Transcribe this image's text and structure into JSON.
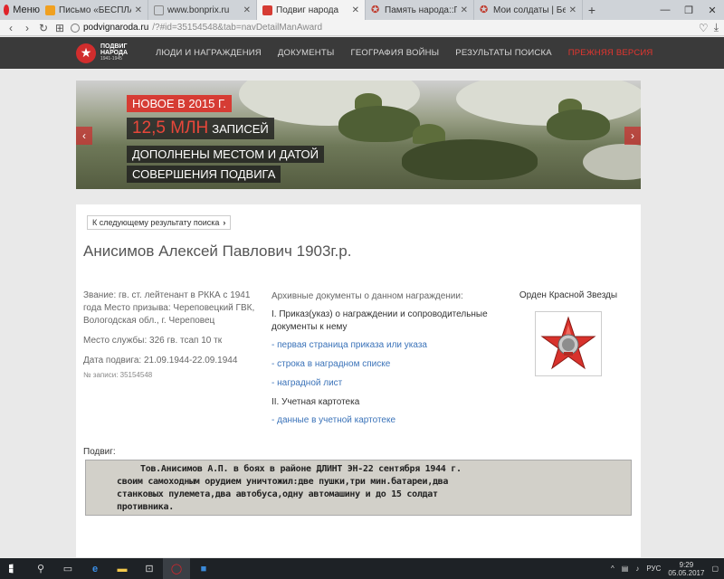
{
  "browser": {
    "menu_label": "Меню",
    "tabs": [
      {
        "title": "Письмо «БЕСПЛАТНАЯ д",
        "color": "#f0a020"
      },
      {
        "title": "www.bonprix.ru",
        "color": "#888888"
      },
      {
        "title": "Подвиг народа",
        "color": "#d63c34"
      },
      {
        "title": "Память народа::Подлинн",
        "color": "#c0392b"
      },
      {
        "title": "Мои солдаты | Бессмерт",
        "color": "#c0392b"
      }
    ],
    "active_tab_index": 2,
    "url_host": "podvignaroda.ru",
    "url_path": "/?#id=35154548&tab=navDetailManAward"
  },
  "site": {
    "logo_lines": [
      "ПОДВИГ",
      "НАРОДА",
      "1941-1945"
    ],
    "nav": [
      "ЛЮДИ И НАГРАЖДЕНИЯ",
      "ДОКУМЕНТЫ",
      "ГЕОГРАФИЯ ВОЙНЫ",
      "РЕЗУЛЬТАТЫ ПОИСКА",
      "ПРЕЖНЯЯ ВЕРСИЯ"
    ]
  },
  "banner": {
    "new_label": "НОВОЕ В 2015 Г.",
    "big_number": "12,5 МЛН",
    "line2": "ЗАПИСЕЙ",
    "line3": "ДОПОЛНЕНЫ МЕСТОМ И ДАТОЙ",
    "line4": "СОВЕРШЕНИЯ ПОДВИГА"
  },
  "record": {
    "next_result_label": "К следующему результату поиска",
    "name": "Анисимов Алексей Павлович 1903г.р.",
    "rank_and_draft": "Звание: гв. ст. лейтенант в РККА с 1941 года Место призыва: Череповецкий ГВК, Вологодская обл., г. Череповец",
    "service_place": "Место службы: 326 гв. тсап 10 тк",
    "deed_date": "Дата подвига: 21.09.1944-22.09.1944",
    "record_no": "№ записи: 35154548",
    "archive_heading": "Архивные документы о данном награждении:",
    "section1": "I. Приказ(указ) о награждении и сопроводительные документы к нему",
    "links1": [
      "- первая страница приказа или указа",
      "- строка в наградном списке",
      "- наградной лист"
    ],
    "section2": "II. Учетная картотека",
    "links2": [
      "- данные в учетной картотеке"
    ],
    "award_title": "Орден Красной Звезды",
    "deed_label": "Подвиг:",
    "deed_text": [
      "Тов.Анисимов А.П. в боях в районе ДЛИНТ ЭН-22 сентября 1944 г.",
      "своим самоходным орудием уничтожил:две пушки,три мин.батареи,два",
      "станковых пулемета,два автобуса,одну автомашину и до 15 солдат",
      "противника."
    ]
  },
  "taskbar": {
    "lang": "РУС",
    "time": "9:29",
    "date": "05.05.2017"
  }
}
